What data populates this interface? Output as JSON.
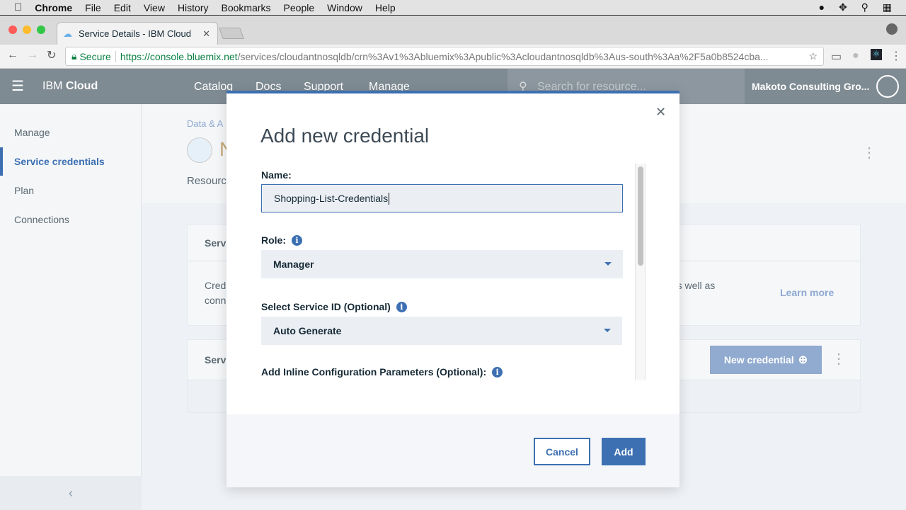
{
  "mac_menu": {
    "app": "Chrome",
    "items": [
      "File",
      "Edit",
      "View",
      "History",
      "Bookmarks",
      "People",
      "Window",
      "Help"
    ]
  },
  "browser": {
    "tab_title": "Service Details - IBM Cloud",
    "secure_label": "Secure",
    "url_host": "https://console.bluemix.net",
    "url_path": "/services/cloudantnosqldb/crn%3Av1%3Abluemix%3Apublic%3Acloudantnosqldb%3Aus-south%3Aa%2F5a0b8524cba..."
  },
  "header": {
    "brand_light": "IBM",
    "brand_bold": "Cloud",
    "nav": [
      "Catalog",
      "Docs",
      "Support",
      "Manage"
    ],
    "search_placeholder": "Search for resource...",
    "account": "Makoto Consulting Gro..."
  },
  "sidebar": {
    "items": [
      "Manage",
      "Service credentials",
      "Plan",
      "Connections"
    ],
    "active": "Service credentials"
  },
  "page": {
    "breadcrumb": "Data & A",
    "title_initial": "N",
    "resource_label": "Resourc",
    "card1_title": "Servi",
    "card1_text1": "Crede",
    "card1_text2": "conn",
    "card1_text_right": ", as well as",
    "learn_more": "Learn more",
    "card2_title": "Servi",
    "new_credential": "New credential"
  },
  "modal": {
    "title": "Add new credential",
    "name_label": "Name:",
    "name_value": "Shopping-List-Credentials",
    "role_label": "Role:",
    "role_value": "Manager",
    "service_id_label": "Select Service ID (Optional)",
    "service_id_value": "Auto Generate",
    "inline_label": "Add Inline Configuration Parameters (Optional):",
    "cancel": "Cancel",
    "add": "Add"
  },
  "colors": {
    "accent": "#3d70b2",
    "header": "#7f8b93"
  }
}
